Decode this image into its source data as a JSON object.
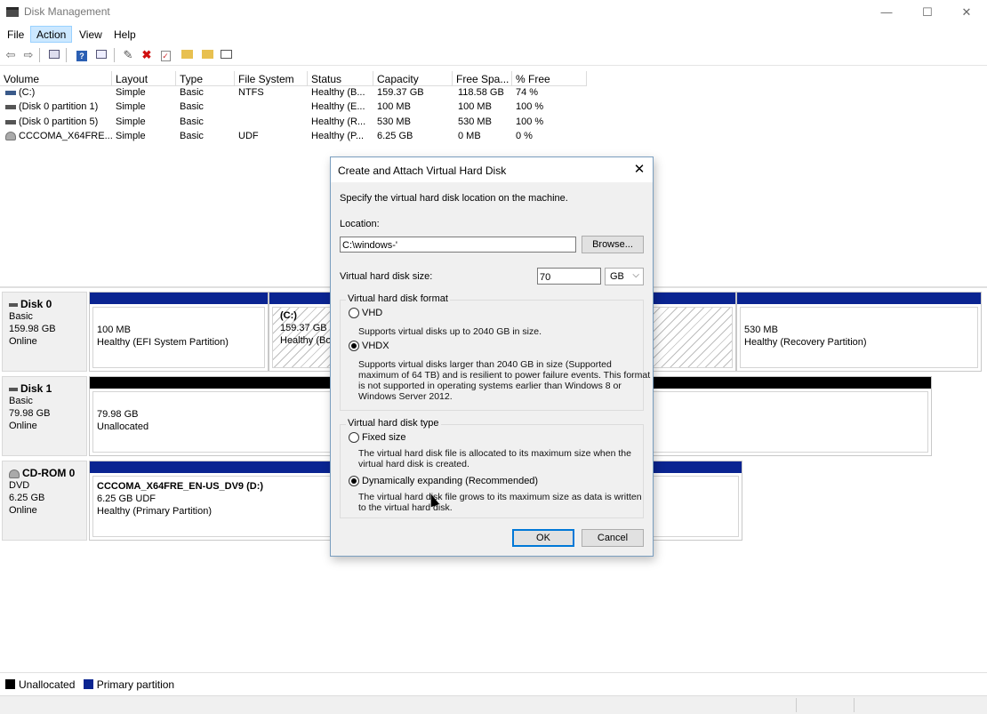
{
  "window": {
    "title": "Disk Management",
    "controls": {
      "minimize": "—",
      "maximize": "☐",
      "close": "✕"
    }
  },
  "menu": [
    "File",
    "Action",
    "View",
    "Help"
  ],
  "toolbar_icons": [
    "back-arrow-icon",
    "forward-arrow-icon",
    "console-tree-icon",
    "help-icon",
    "properties-icon",
    "connect-icon",
    "delete-icon",
    "check-icon",
    "folder-up-icon",
    "folder-search-icon",
    "list-view-icon"
  ],
  "volume_table": {
    "columns": [
      "Volume",
      "Layout",
      "Type",
      "File System",
      "Status",
      "Capacity",
      "Free Spa...",
      "% Free"
    ],
    "rows": [
      {
        "volume": "(C:)",
        "layout": "Simple",
        "type": "Basic",
        "fs": "NTFS",
        "status": "Healthy (B...",
        "capacity": "159.37 GB",
        "free": "118.58 GB",
        "pct": "74 %",
        "icon": "drive-icon"
      },
      {
        "volume": "(Disk 0 partition 1)",
        "layout": "Simple",
        "type": "Basic",
        "fs": "",
        "status": "Healthy (E...",
        "capacity": "100 MB",
        "free": "100 MB",
        "pct": "100 %",
        "icon": "partition-icon"
      },
      {
        "volume": "(Disk 0 partition 5)",
        "layout": "Simple",
        "type": "Basic",
        "fs": "",
        "status": "Healthy (R...",
        "capacity": "530 MB",
        "free": "530 MB",
        "pct": "100 %",
        "icon": "partition-icon"
      },
      {
        "volume": "CCCOMA_X64FRE...",
        "layout": "Simple",
        "type": "Basic",
        "fs": "UDF",
        "status": "Healthy (P...",
        "capacity": "6.25 GB",
        "free": "0 MB",
        "pct": "0 %",
        "icon": "cd-drive-icon"
      }
    ]
  },
  "disks": [
    {
      "name": "Disk 0",
      "kind": "Basic",
      "size": "159.98 GB",
      "state": "Online",
      "partitions": [
        {
          "line1": "100 MB",
          "line2": "Healthy (EFI System Partition)"
        },
        {
          "title": "(C:)",
          "line1": "159.37 GB N",
          "line2": "Healthy (Bo"
        },
        {
          "line1": "530 MB",
          "line2": "Healthy (Recovery Partition)"
        }
      ]
    },
    {
      "name": "Disk 1",
      "kind": "Basic",
      "size": "79.98 GB",
      "state": "Online",
      "partitions": [
        {
          "line1": "79.98 GB",
          "line2": "Unallocated"
        }
      ]
    },
    {
      "name": "CD-ROM 0",
      "kind": "DVD",
      "size": "6.25 GB",
      "state": "Online",
      "partitions": [
        {
          "title": "CCCOMA_X64FRE_EN-US_DV9  (D:)",
          "line1": "6.25 GB UDF",
          "line2": "Healthy (Primary Partition)"
        }
      ]
    }
  ],
  "legend": [
    {
      "label": "Unallocated",
      "color": "#000000"
    },
    {
      "label": "Primary partition",
      "color": "#0a2491"
    }
  ],
  "dialog": {
    "title": "Create and Attach Virtual Hard Disk",
    "instruction": "Specify the virtual hard disk location on the machine.",
    "location_label": "Location:",
    "location_value": "C:\\windows-'",
    "browse": "Browse...",
    "size_label": "Virtual hard disk size:",
    "size_value": "70",
    "size_unit": "GB",
    "format_group": "Virtual hard disk format",
    "vhd_label": "VHD",
    "vhd_desc": "Supports virtual disks up to 2040 GB in size.",
    "vhdx_label": "VHDX",
    "vhdx_desc": [
      "Supports virtual disks larger than 2040 GB in size (Supported",
      "maximum of 64 TB) and is resilient to power failure events. This format",
      "is not supported in operating systems earlier than Windows 8 or",
      "Windows Server 2012."
    ],
    "selected_format": "VHDX",
    "type_group": "Virtual hard disk type",
    "fixed_label": "Fixed size",
    "fixed_desc": [
      "The virtual hard disk file is allocated to its maximum size when the",
      "virtual hard disk is created."
    ],
    "dynamic_label": "Dynamically expanding (Recommended)",
    "dynamic_desc": [
      "The virtual hard disk file grows to its maximum size as data is written",
      "to the virtual hard disk."
    ],
    "selected_type": "Dynamically expanding (Recommended)",
    "ok": "OK",
    "cancel": "Cancel",
    "close": "✕"
  }
}
